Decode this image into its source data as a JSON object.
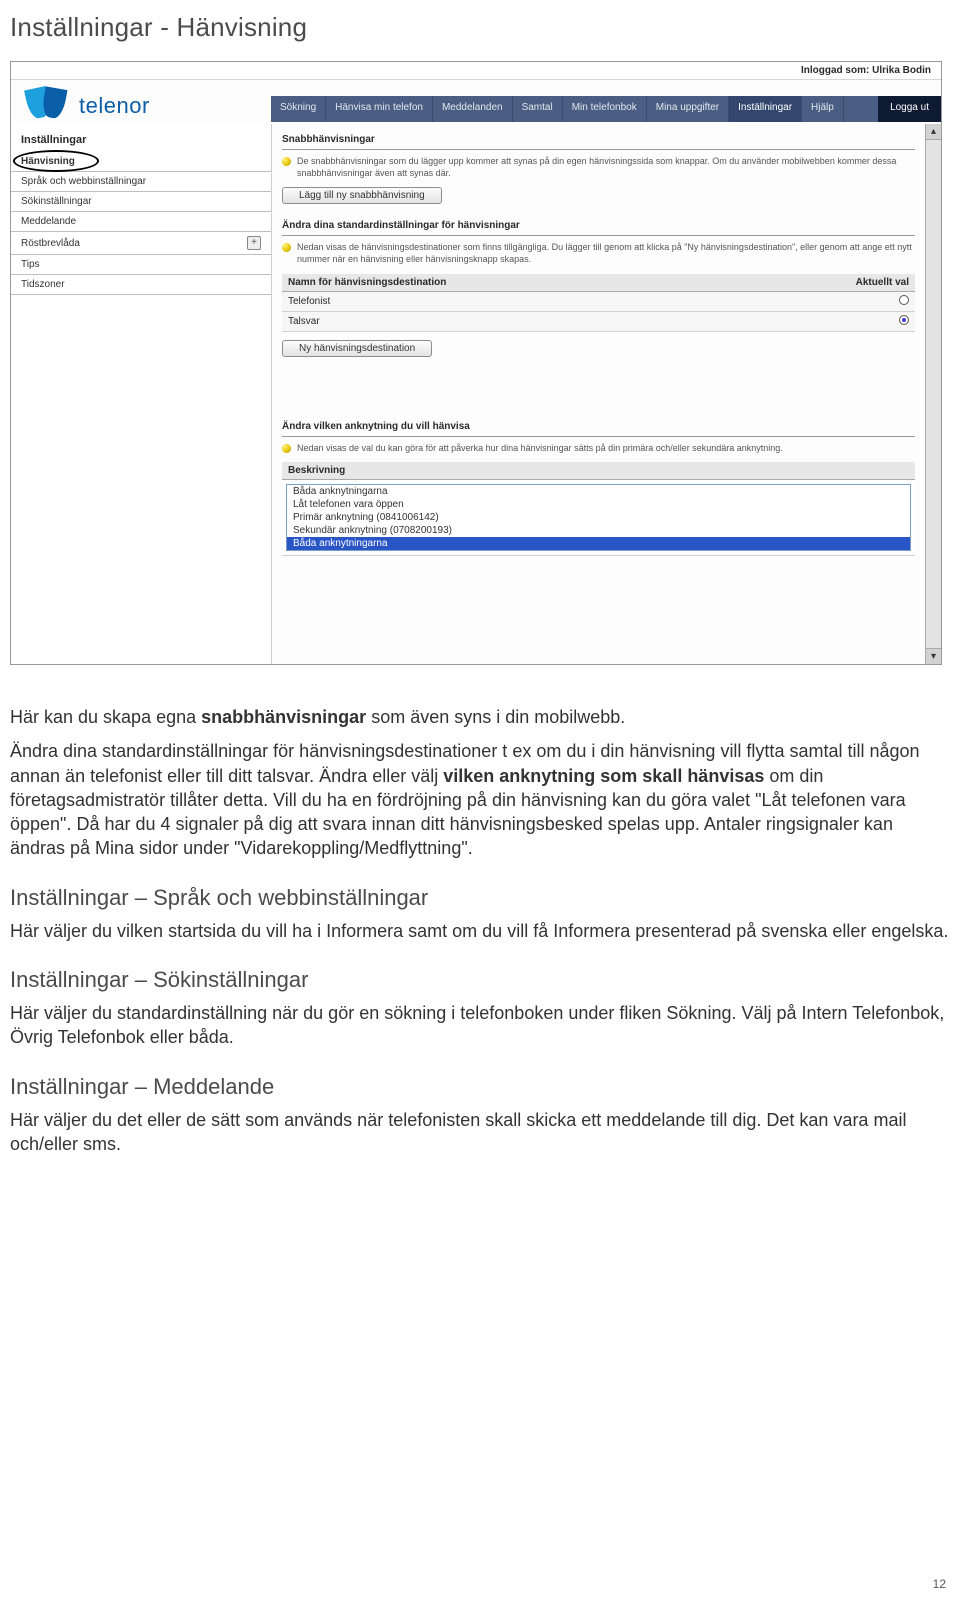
{
  "page": {
    "title": "Inställningar - Hänvisning",
    "page_number": "12"
  },
  "app": {
    "top_login_label": "Inloggad som:",
    "top_login_user": "Ulrika Bodin",
    "brand": "telenor",
    "nav": {
      "items": [
        "Sökning",
        "Hänvisa min telefon",
        "Meddelanden",
        "Samtal",
        "Min telefonbok",
        "Mina uppgifter",
        "Inställningar",
        "Hjälp"
      ],
      "active": "Inställningar",
      "logout": "Logga ut"
    },
    "sidebar": {
      "title": "Inställningar",
      "items": [
        {
          "label": "Hänvisning",
          "selected": true
        },
        {
          "label": "Språk och webbinställningar"
        },
        {
          "label": "Sökinställningar"
        },
        {
          "label": "Meddelande"
        },
        {
          "label": "Röstbrevlåda",
          "expand": true
        },
        {
          "label": "Tips"
        },
        {
          "label": "Tidszoner"
        }
      ]
    },
    "panel1": {
      "title": "Snabbhänvisningar",
      "hint": "De snabbhänvisningar som du lägger upp kommer att synas på din egen hänvisningssida som knappar. Om du använder mobilwebben kommer dessa snabbhänvisningar även att synas där.",
      "button": "Lägg till ny snabbhänvisning"
    },
    "panel2": {
      "title": "Ändra dina standardinställningar för hänvisningar",
      "hint": "Nedan visas de hänvisningsdestinationer som finns tillgängliga. Du lägger till genom att klicka på \"Ny hänvisningsdestination\", eller genom att ange ett nytt nummer när en hänvisning eller hänvisningsknapp skapas.",
      "col1": "Namn för hänvisningsdestination",
      "col2": "Aktuellt val",
      "rows": [
        {
          "name": "Telefonist",
          "checked": false
        },
        {
          "name": "Talsvar",
          "checked": true
        }
      ],
      "button": "Ny hänvisningsdestination"
    },
    "panel3": {
      "title": "Ändra vilken anknytning du vill hänvisa",
      "hint": "Nedan visas de val du kan göra för att påverka hur dina hänvisningar sätts på din primära och/eller sekundära anknytning.",
      "list_label": "Beskrivning",
      "options": [
        "Båda anknytningarna",
        "Låt telefonen vara öppen",
        "Primär anknytning (0841006142)",
        "Sekundär anknytning (0708200193)",
        "Båda anknytningarna"
      ],
      "selected_index": 4
    }
  },
  "doc": {
    "intro_pre": "Här kan du skapa egna ",
    "intro_bold": "snabbhänvisningar",
    "intro_post": " som även syns i din mobilwebb.",
    "p2_a": "Ändra dina standardinställningar för hänvisningsdestinationer t ex om du i din hänvisning vill flytta samtal till någon annan än telefonist eller till ditt talsvar. Ändra eller välj ",
    "p2_b_bold": "vilken anknytning som skall hänvisas",
    "p2_c": " om din företagsadmistratör tillåter detta. Vill du ha en fördröjning på din hänvisning kan du göra valet \"Låt telefonen vara öppen\". Då har du 4 signaler på dig att svara innan ditt hänvisningsbesked spelas upp. Antaler ringsignaler kan ändras på Mina sidor under \"Vidarekoppling/Medflyttning\".",
    "h2a": "Inställningar – Språk och webbinställningar",
    "p3": "Här väljer du vilken startsida du vill ha i Informera samt om du vill få Informera presenterad på svenska eller engelska.",
    "h2b": "Inställningar – Sökinställningar",
    "p4": "Här väljer du standardinställning när du gör en sökning i telefonboken under fliken Sökning. Välj på Intern Telefonbok, Övrig Telefonbok eller båda.",
    "h2c": "Inställningar – Meddelande",
    "p5": "Här väljer du det eller de sätt som används när telefonisten skall skicka ett meddelande  till dig. Det kan vara mail och/eller sms."
  }
}
